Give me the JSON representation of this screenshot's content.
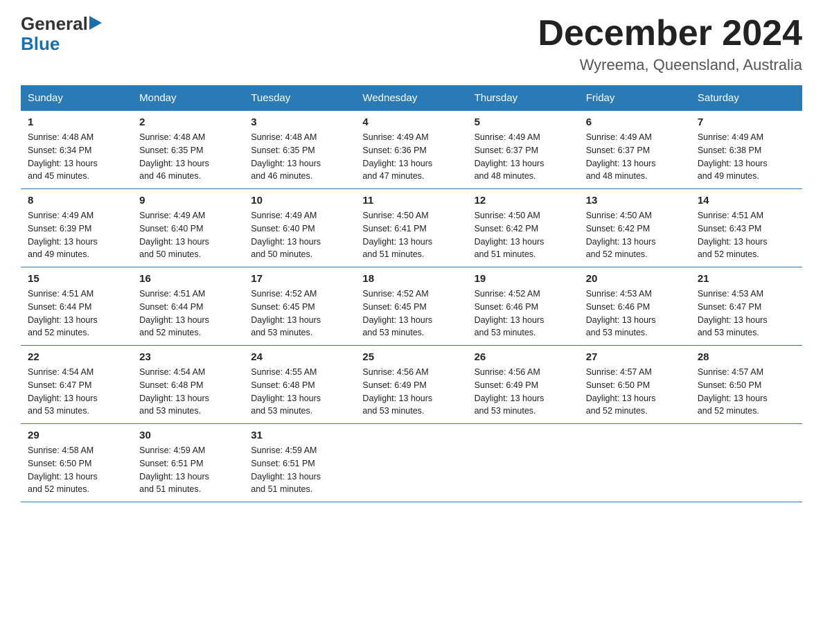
{
  "header": {
    "logo": {
      "text_general": "General",
      "text_blue": "Blue",
      "arrow": "▶"
    },
    "title": "December 2024",
    "subtitle": "Wyreema, Queensland, Australia"
  },
  "days_of_week": [
    "Sunday",
    "Monday",
    "Tuesday",
    "Wednesday",
    "Thursday",
    "Friday",
    "Saturday"
  ],
  "weeks": [
    [
      {
        "day": "1",
        "sunrise": "4:48 AM",
        "sunset": "6:34 PM",
        "daylight": "13 hours and 45 minutes."
      },
      {
        "day": "2",
        "sunrise": "4:48 AM",
        "sunset": "6:35 PM",
        "daylight": "13 hours and 46 minutes."
      },
      {
        "day": "3",
        "sunrise": "4:48 AM",
        "sunset": "6:35 PM",
        "daylight": "13 hours and 46 minutes."
      },
      {
        "day": "4",
        "sunrise": "4:49 AM",
        "sunset": "6:36 PM",
        "daylight": "13 hours and 47 minutes."
      },
      {
        "day": "5",
        "sunrise": "4:49 AM",
        "sunset": "6:37 PM",
        "daylight": "13 hours and 48 minutes."
      },
      {
        "day": "6",
        "sunrise": "4:49 AM",
        "sunset": "6:37 PM",
        "daylight": "13 hours and 48 minutes."
      },
      {
        "day": "7",
        "sunrise": "4:49 AM",
        "sunset": "6:38 PM",
        "daylight": "13 hours and 49 minutes."
      }
    ],
    [
      {
        "day": "8",
        "sunrise": "4:49 AM",
        "sunset": "6:39 PM",
        "daylight": "13 hours and 49 minutes."
      },
      {
        "day": "9",
        "sunrise": "4:49 AM",
        "sunset": "6:40 PM",
        "daylight": "13 hours and 50 minutes."
      },
      {
        "day": "10",
        "sunrise": "4:49 AM",
        "sunset": "6:40 PM",
        "daylight": "13 hours and 50 minutes."
      },
      {
        "day": "11",
        "sunrise": "4:50 AM",
        "sunset": "6:41 PM",
        "daylight": "13 hours and 51 minutes."
      },
      {
        "day": "12",
        "sunrise": "4:50 AM",
        "sunset": "6:42 PM",
        "daylight": "13 hours and 51 minutes."
      },
      {
        "day": "13",
        "sunrise": "4:50 AM",
        "sunset": "6:42 PM",
        "daylight": "13 hours and 52 minutes."
      },
      {
        "day": "14",
        "sunrise": "4:51 AM",
        "sunset": "6:43 PM",
        "daylight": "13 hours and 52 minutes."
      }
    ],
    [
      {
        "day": "15",
        "sunrise": "4:51 AM",
        "sunset": "6:44 PM",
        "daylight": "13 hours and 52 minutes."
      },
      {
        "day": "16",
        "sunrise": "4:51 AM",
        "sunset": "6:44 PM",
        "daylight": "13 hours and 52 minutes."
      },
      {
        "day": "17",
        "sunrise": "4:52 AM",
        "sunset": "6:45 PM",
        "daylight": "13 hours and 53 minutes."
      },
      {
        "day": "18",
        "sunrise": "4:52 AM",
        "sunset": "6:45 PM",
        "daylight": "13 hours and 53 minutes."
      },
      {
        "day": "19",
        "sunrise": "4:52 AM",
        "sunset": "6:46 PM",
        "daylight": "13 hours and 53 minutes."
      },
      {
        "day": "20",
        "sunrise": "4:53 AM",
        "sunset": "6:46 PM",
        "daylight": "13 hours and 53 minutes."
      },
      {
        "day": "21",
        "sunrise": "4:53 AM",
        "sunset": "6:47 PM",
        "daylight": "13 hours and 53 minutes."
      }
    ],
    [
      {
        "day": "22",
        "sunrise": "4:54 AM",
        "sunset": "6:47 PM",
        "daylight": "13 hours and 53 minutes."
      },
      {
        "day": "23",
        "sunrise": "4:54 AM",
        "sunset": "6:48 PM",
        "daylight": "13 hours and 53 minutes."
      },
      {
        "day": "24",
        "sunrise": "4:55 AM",
        "sunset": "6:48 PM",
        "daylight": "13 hours and 53 minutes."
      },
      {
        "day": "25",
        "sunrise": "4:56 AM",
        "sunset": "6:49 PM",
        "daylight": "13 hours and 53 minutes."
      },
      {
        "day": "26",
        "sunrise": "4:56 AM",
        "sunset": "6:49 PM",
        "daylight": "13 hours and 53 minutes."
      },
      {
        "day": "27",
        "sunrise": "4:57 AM",
        "sunset": "6:50 PM",
        "daylight": "13 hours and 52 minutes."
      },
      {
        "day": "28",
        "sunrise": "4:57 AM",
        "sunset": "6:50 PM",
        "daylight": "13 hours and 52 minutes."
      }
    ],
    [
      {
        "day": "29",
        "sunrise": "4:58 AM",
        "sunset": "6:50 PM",
        "daylight": "13 hours and 52 minutes."
      },
      {
        "day": "30",
        "sunrise": "4:59 AM",
        "sunset": "6:51 PM",
        "daylight": "13 hours and 51 minutes."
      },
      {
        "day": "31",
        "sunrise": "4:59 AM",
        "sunset": "6:51 PM",
        "daylight": "13 hours and 51 minutes."
      },
      null,
      null,
      null,
      null
    ]
  ],
  "labels": {
    "sunrise": "Sunrise:",
    "sunset": "Sunset:",
    "daylight": "Daylight:"
  }
}
